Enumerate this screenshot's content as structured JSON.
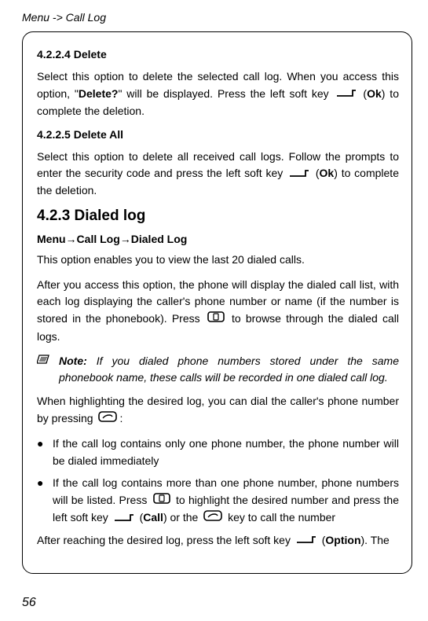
{
  "header": {
    "breadcrumb": "Menu -> Call Log"
  },
  "s1": {
    "title": "4.2.2.4 Delete",
    "p1a": "Select this option to delete the selected call log. When you access this option, \"",
    "p1b": "Delete?",
    "p1c": "\" will be displayed. Press the left soft key ",
    "p1d": " (",
    "p1e": "Ok",
    "p1f": ") to complete the deletion."
  },
  "s2": {
    "title": "4.2.2.5 Delete All",
    "p1a": "Select this option to delete all received call logs. Follow the prompts to enter the security code and press the left soft key ",
    "p1b": " (",
    "p1c": "Ok",
    "p1d": ") to complete the deletion."
  },
  "s3": {
    "title": "4.2.3 Dialed log",
    "nav": "Menu→Call Log→Dialed Log",
    "p1": "This option enables you to view the last 20 dialed calls.",
    "p2a": "After you access this option, the phone will display the dialed call list, with each log displaying the caller's phone number or name (if the number is stored in the phonebook). Press ",
    "p2b": " to browse through the dialed call logs.",
    "note_label": "Note:",
    "note_text": " If you dialed phone numbers stored under the same phonebook name, these calls will be recorded in one dialed call log.",
    "p3a": "When highlighting the desired log, you can dial the caller's phone number by pressing ",
    "p3b": ":",
    "b1": "If the call log contains only one phone number, the phone number will be dialed immediately",
    "b2a": "If the call log contains more than one phone number, phone numbers will be listed. Press ",
    "b2b": " to highlight the desired number and press the left soft key ",
    "b2c": " (",
    "b2d": "Call",
    "b2e": ") or the ",
    "b2f": " key to call the number",
    "p4a": "After reaching the desired log, press the left soft key ",
    "p4b": " (",
    "p4c": "Option",
    "p4d": "). The"
  },
  "page_number": "56",
  "glyphs": {
    "bullet": "●"
  }
}
